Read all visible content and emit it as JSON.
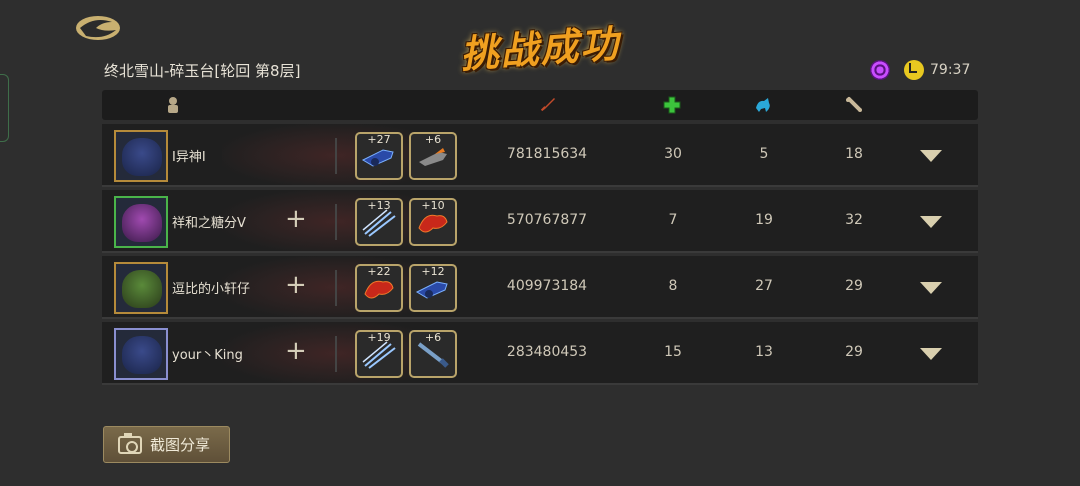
{
  "title": "挑战成功",
  "location": "终北雪山-碎玉台[轮回  第8层]",
  "timer": "79:37",
  "share_button": "截图分享",
  "header_icons": [
    "player-icon",
    "sword-icon",
    "green-plus-icon",
    "blue-beast-icon",
    "bone-icon"
  ],
  "players": [
    {
      "name": "I异神I",
      "show_add": false,
      "power": "781815634",
      "heal": "30",
      "summon": "5",
      "bone": "18",
      "avatar": "blue-wolf",
      "weapons": [
        {
          "level": "+27",
          "icon": "blue-cannon-icon"
        },
        {
          "level": "+6",
          "icon": "orange-gun-icon"
        }
      ]
    },
    {
      "name": "祥和之糖分V",
      "show_add": true,
      "power": "570767877",
      "heal": "7",
      "summon": "19",
      "bone": "32",
      "avatar": "purple-beast",
      "weapons": [
        {
          "level": "+13",
          "icon": "blue-daggers-icon"
        },
        {
          "level": "+10",
          "icon": "red-dragon-icon"
        }
      ]
    },
    {
      "name": "逗比的小轩仔",
      "show_add": true,
      "power": "409973184",
      "heal": "8",
      "summon": "27",
      "bone": "29",
      "avatar": "green-witch",
      "weapons": [
        {
          "level": "+22",
          "icon": "red-dragon-icon"
        },
        {
          "level": "+12",
          "icon": "blue-cannon-icon"
        }
      ]
    },
    {
      "name": "your丶King",
      "show_add": true,
      "power": "283480453",
      "heal": "15",
      "summon": "13",
      "bone": "29",
      "avatar": "blue-wolf",
      "weapons": [
        {
          "level": "+19",
          "icon": "blue-daggers-icon"
        },
        {
          "level": "+6",
          "icon": "blue-sword-icon"
        }
      ]
    }
  ],
  "colors": {
    "accent": "#f0a020",
    "slot_border": "#b9a46a",
    "timer_icon": "#e8c820",
    "spiral_icon": "#c84cff"
  }
}
